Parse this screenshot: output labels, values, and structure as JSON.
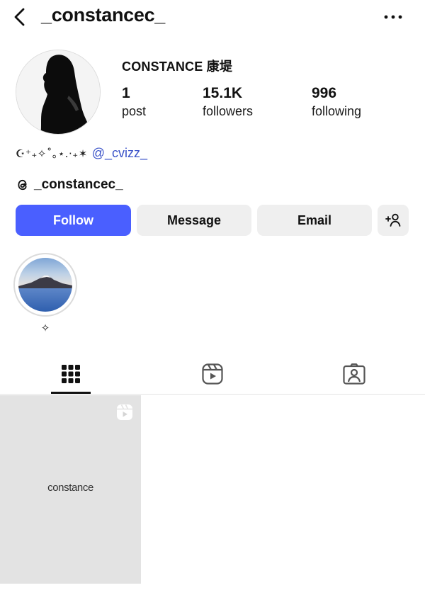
{
  "header": {
    "username": "_constancec_",
    "back_icon": "chevron-left-icon",
    "more_icon": "ellipsis-icon"
  },
  "profile": {
    "display_name": "CONSTANCE 康堤",
    "stats": {
      "posts": {
        "value": "1",
        "label": "post"
      },
      "followers": {
        "value": "15.1K",
        "label": "followers"
      },
      "following": {
        "value": "996",
        "label": "following"
      }
    },
    "bio": {
      "decoration": "☪⁺₊✧˚｡⋆.·₊✶",
      "mention": "@_cvizz_"
    },
    "threads_handle": "_constancec_"
  },
  "actions": {
    "follow_label": "Follow",
    "message_label": "Message",
    "email_label": "Email",
    "suggest_icon": "add-person-icon"
  },
  "highlights": [
    {
      "label": "✧"
    }
  ],
  "tabs": [
    {
      "name": "grid",
      "icon": "grid-icon",
      "active": true
    },
    {
      "name": "reels",
      "icon": "reels-icon",
      "active": false
    },
    {
      "name": "tagged",
      "icon": "tagged-person-icon",
      "active": false
    }
  ],
  "posts": [
    {
      "text": "constance",
      "type": "reel"
    }
  ],
  "colors": {
    "accent": "#4a5fff",
    "mention": "#3a52c8",
    "button_bg": "#efefef",
    "post_bg": "#e3e3e3"
  }
}
